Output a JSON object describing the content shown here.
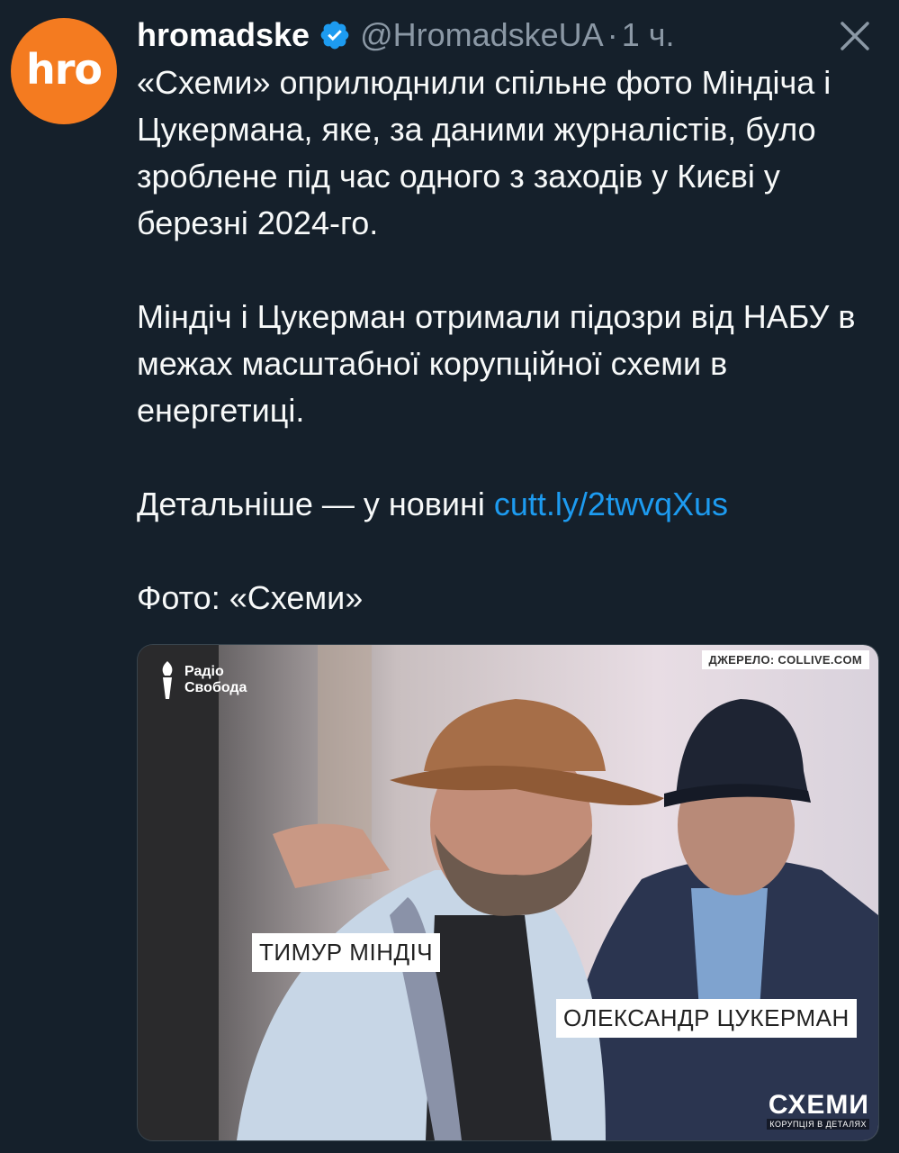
{
  "tweet": {
    "avatar_text": "hro",
    "display_name": "hromadske",
    "handle": "@HromadskeUA",
    "separator": "·",
    "time": "1 ч.",
    "body": {
      "p1": "«Схеми» оприлюднили спільне фото Міндіча і Цукермана, яке, за даними журналістів, було зроблене під час одного з заходів у Києві у березні 2024-го.",
      "p2": "Міндіч і Цукерман отримали підозри від НАБУ в межах масштабної корупційної схеми в енергетиці.",
      "p3_text": "Детальніше — у новині ",
      "p3_link": "cutt.ly/2twvqXus",
      "p4": "Фото: «Схеми»"
    },
    "media": {
      "source_label": "ДЖЕРЕЛО: COLLIVE.COM",
      "radio_logo": "Радіо Свобода",
      "name_left": "ТИМУР МІНДІЧ",
      "name_right": "ОЛЕКСАНДР ЦУКЕРМАН",
      "schemes_title": "СХЕМИ",
      "schemes_subtitle": "КОРУПЦІЯ В ДЕТАЛЯХ"
    }
  },
  "colors": {
    "background": "#15202b",
    "text": "#f7f9f9",
    "muted": "#8b98a5",
    "link": "#1d9bf0",
    "avatar": "#f47b20",
    "verified": "#1d9bf0"
  },
  "icons": {
    "verified": "verified-badge-icon",
    "close": "close-icon"
  }
}
